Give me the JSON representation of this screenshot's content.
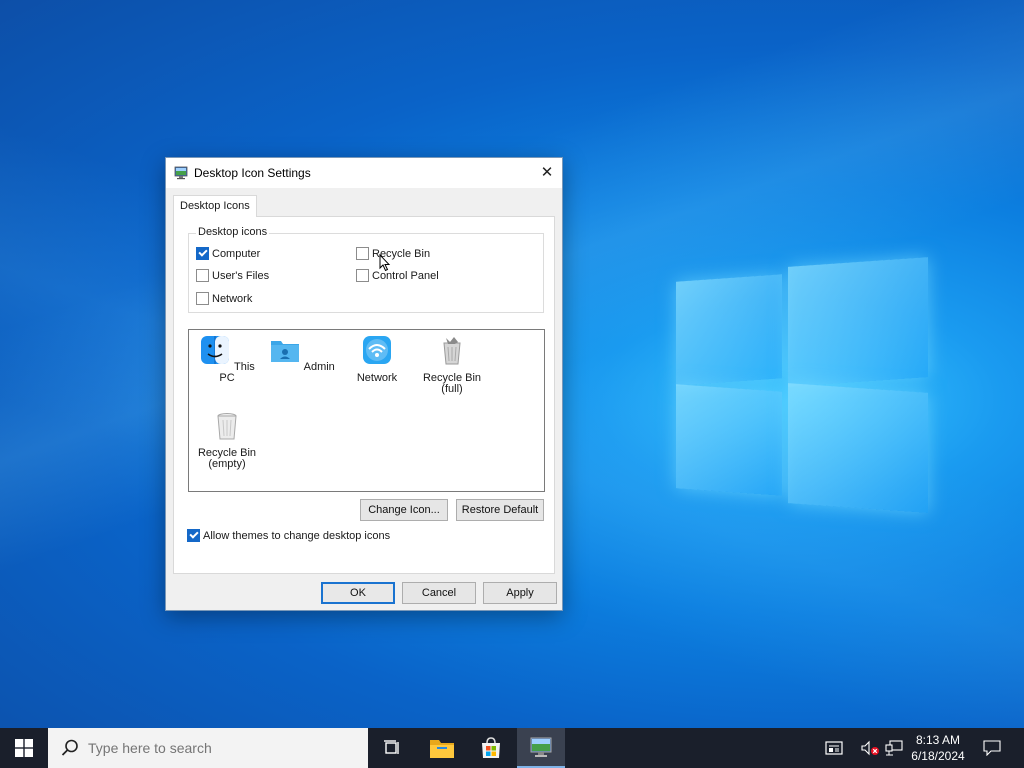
{
  "dialog": {
    "title": "Desktop Icon Settings",
    "close_glyph": "✕",
    "tab_label": "Desktop Icons",
    "group_label": "Desktop icons",
    "checkboxes": [
      {
        "label": "Computer",
        "checked": true
      },
      {
        "label": "User's Files",
        "checked": false
      },
      {
        "label": "Network",
        "checked": false
      },
      {
        "label": "Recycle Bin",
        "checked": false
      },
      {
        "label": "Control Panel",
        "checked": false
      }
    ],
    "icons": [
      {
        "label": "This PC",
        "icon": "this-pc-icon"
      },
      {
        "label": "Admin",
        "icon": "user-folder-icon"
      },
      {
        "label": "Network",
        "icon": "network-icon"
      },
      {
        "label": "Recycle Bin (full)",
        "icon": "recycle-bin-full-icon"
      },
      {
        "label": "Recycle Bin (empty)",
        "icon": "recycle-bin-empty-icon"
      }
    ],
    "change_icon_label": "Change Icon...",
    "restore_default_label": "Restore Default",
    "allow_themes_label": "Allow themes to change desktop icons",
    "allow_themes_checked": true,
    "ok_label": "OK",
    "cancel_label": "Cancel",
    "apply_label": "Apply"
  },
  "taskbar": {
    "search_placeholder": "Type here to search",
    "time": "8:13 AM",
    "date": "6/18/2024"
  },
  "colors": {
    "accent": "#1468c8",
    "taskbar": "#1a1f2b"
  }
}
